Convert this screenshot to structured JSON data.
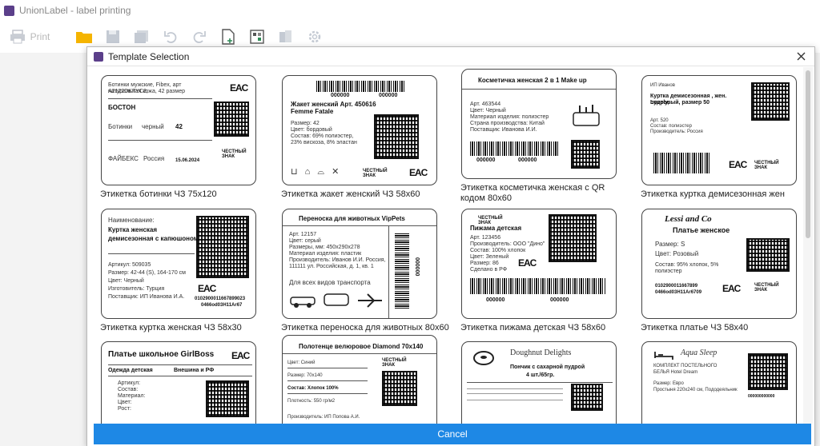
{
  "app": {
    "title": "UnionLabel - label printing"
  },
  "toolbar": {
    "print_label": "Print",
    "icons": [
      "open-folder-icon",
      "save-icon",
      "save-all-icon",
      "undo-icon",
      "redo-icon",
      "new-document-icon",
      "qr-label-icon",
      "layers-icon",
      "settings-icon"
    ],
    "zoom": {
      "value": 0.1
    }
  },
  "dialog": {
    "title": "Template Selection",
    "cancel_label": "Cancel",
    "templates": [
      {
        "caption": "Этикетка ботинки ЧЗ 75х120",
        "lines": [
          "Ботинки мужские, Fibex, арт A2122DKTYC3,",
          "натуральная кожа, 42 размер",
          "БОСТОН",
          "Ботинки",
          "черный",
          "42",
          "ФАЙБЕКС",
          "Россия",
          "15.06.2024"
        ]
      },
      {
        "caption": "Этикетка жакет женский ЧЗ 58х60",
        "lines": [
          "000000",
          "000000",
          "Жакет женский Арт. 450616",
          "Femme Fatale",
          "Размер: 42",
          "Цвет: бордовый",
          "Состав: 69% полиэстер,",
          "23% вискоза, 8% эластан"
        ]
      },
      {
        "caption": "Этикетка косметичка женская с QR кодом 80х60",
        "lines": [
          "Косметичка женская 2 в 1 Make up",
          "Арт. 463544",
          "Цвет: Черный",
          "Материал изделия: полиэстер",
          "Страна производства: Китай",
          "Поставщик: Иванова И.И.",
          "000000",
          "000000"
        ]
      },
      {
        "caption": "Этикетка куртка демисезонная жен",
        "lines": [
          "ИП Иванов",
          "Куртка демисезонная , жен. Lovely,",
          "пудровый, размер 50",
          "Арт. 520",
          "Состав: полиэстер",
          "Производитель: Россия"
        ]
      },
      {
        "caption": "Этикетка куртка женская ЧЗ 58х30",
        "lines": [
          "Наименование:",
          "Куртка женская",
          "демисезонная с капюшоном",
          "Артикул: 509035",
          "Размер: 42-44 (S), 164-170 см",
          "Цвет: Черный",
          "Изготовитель: Турция",
          "Поставщик: ИП Иванова И.А.",
          "0102900011667899023",
          "0466od03H11Ar67"
        ]
      },
      {
        "caption": "Этикетка переноска для животных 80х60",
        "lines": [
          "Переноска для животных VipPets",
          "Арт. 12157",
          "Цвет: серый",
          "Размеры, мм: 450х290х278",
          "Материал изделия: пластик",
          "Производитель: Иванов И.И. Россия,",
          "111111 ул. Российская, д. 1, кв. 1",
          "Для всех видов транспорта",
          "000000"
        ]
      },
      {
        "caption": "Этикетка пижама детская ЧЗ 58х60",
        "lines": [
          "Пижама детская",
          "Арт. 123456",
          "Производитель: ООО \"Дино\"",
          "Состав: 100% хлопок",
          "Цвет: Зеленый",
          "Размер: 86",
          "Сделано в РФ",
          "000000",
          "000000"
        ]
      },
      {
        "caption": "Этикетка платье ЧЗ 58х40",
        "lines": [
          "Lessi and Co",
          "Платье женское",
          "Размер: S",
          "Цвет: Розовый",
          "Состав: 95% хлопок, 5%",
          "полиэстер",
          "0102900011667899",
          "0466od03H11Ar6709"
        ]
      },
      {
        "caption": "",
        "lines": [
          "Платье школьное GirlBoss",
          "Одежда детская",
          "Внешина и РФ",
          "Артикул:",
          "Состав:",
          "Материал:",
          "Цвет:",
          "Рост:"
        ]
      },
      {
        "caption": "",
        "lines": [
          "Полотенце велюровое Diamond 70x140",
          "Цвет: Синий",
          "Размер: 70x140",
          "Состав: Хлопок 100%",
          "Плотность: 550 гр/м2",
          "Производитель: ИП Попова А.И."
        ]
      },
      {
        "caption": "",
        "lines": [
          "Doughnut Delights",
          "Пончик с сахарной пудрой",
          "4 шт./65гр."
        ]
      },
      {
        "caption": "",
        "lines": [
          "Aqua Sleep",
          "КОМПЛЕКТ ПОСТЕЛЬНОГО",
          "БЕЛЬЯ Hotel Dream",
          "Размер: Евро",
          "Простыня 220х240 см, Пододеяльник",
          "000000000000"
        ]
      }
    ]
  }
}
